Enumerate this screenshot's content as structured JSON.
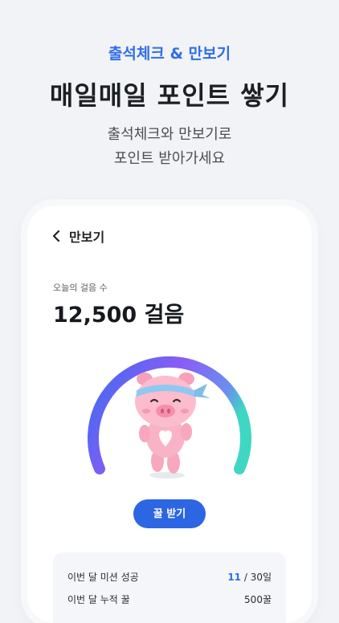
{
  "promo": {
    "subtitle": "출석체크 & 만보기",
    "title": "매일매일 포인트 쌓기",
    "desc_line1": "출석체크와 만보기로",
    "desc_line2": "포인트 받아가세요"
  },
  "screen": {
    "header_title": "만보기",
    "steps_label": "오늘의 걸음 수",
    "steps_value": "12,500 걸음",
    "button_label": "꿀 받기",
    "stats": [
      {
        "label": "이번 달 미션 성공",
        "value_highlight": "11",
        "value_rest": " / 30일"
      },
      {
        "label": "이번 달 누적 꿀",
        "value": "500꿀"
      }
    ]
  },
  "colors": {
    "accent": "#2f6ee6",
    "gauge_start": "#3f6bf0",
    "gauge_mid": "#8a5cf6",
    "gauge_end": "#3fd6c4"
  }
}
